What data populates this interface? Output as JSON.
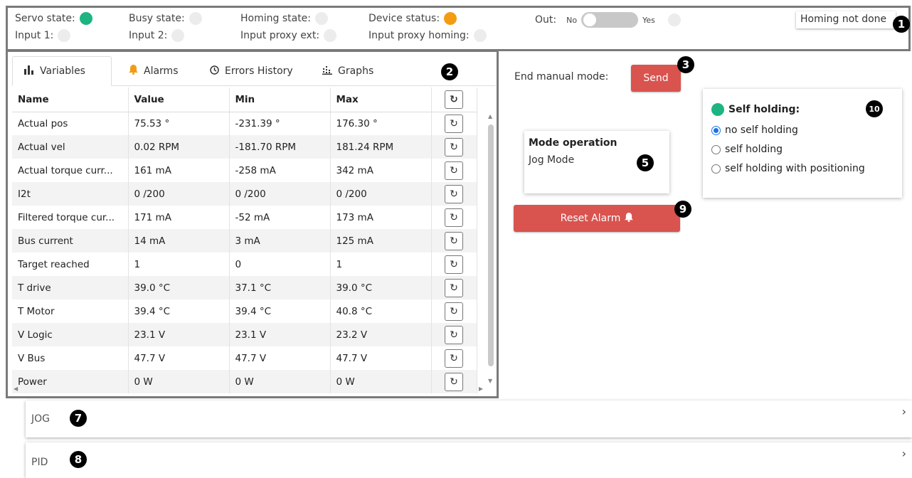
{
  "status": {
    "servo_state": "Servo state:",
    "busy_state": "Busy state:",
    "homing_state": "Homing state:",
    "device_status": "Device status:",
    "out_label": "Out:",
    "out_no": "No",
    "out_yes": "Yes",
    "input1": "Input 1:",
    "input2": "Input 2:",
    "input_proxy_ext": "Input proxy ext:",
    "input_proxy_homing": "Input proxy homing:",
    "homing_message": "Homing not done",
    "colors": {
      "green": "#1db481",
      "orange": "#f39c12",
      "off": "#ececec"
    }
  },
  "markers": {
    "m1": "1",
    "m2": "2",
    "m3": "3",
    "m5": "5",
    "m7": "7",
    "m8": "8",
    "m9": "9",
    "m10": "10"
  },
  "tabs": [
    {
      "label": "Variables",
      "icon": "bar-chart-icon"
    },
    {
      "label": "Alarms",
      "icon": "bell-icon"
    },
    {
      "label": "Errors History",
      "icon": "clock-icon"
    },
    {
      "label": "Graphs",
      "icon": "graph-icon"
    }
  ],
  "table": {
    "headers": [
      "Name",
      "Value",
      "Min",
      "Max"
    ],
    "rows": [
      [
        "Actual pos",
        "75.53 °",
        "-231.39 °",
        "176.30 °"
      ],
      [
        "Actual vel",
        "0.02 RPM",
        "-181.70 RPM",
        "181.24 RPM"
      ],
      [
        "Actual torque curr...",
        "161 mA",
        "-258 mA",
        "342 mA"
      ],
      [
        "I2t",
        "0 /200",
        "0 /200",
        "0 /200"
      ],
      [
        "Filtered torque cur...",
        "171 mA",
        "-52 mA",
        "173 mA"
      ],
      [
        "Bus current",
        "14 mA",
        "3 mA",
        "125 mA"
      ],
      [
        "Target reached",
        "1",
        "0",
        "1"
      ],
      [
        "T drive",
        "39.0 °C",
        "37.1 °C",
        "39.0 °C"
      ],
      [
        "T Motor",
        "39.4 °C",
        "39.4 °C",
        "40.8 °C"
      ],
      [
        "V Logic",
        "23.1 V",
        "23.1 V",
        "23.2 V"
      ],
      [
        "V Bus",
        "47.7 V",
        "47.7 V",
        "47.7 V"
      ],
      [
        "Power",
        "0 W",
        "0 W",
        "0 W"
      ]
    ]
  },
  "manual": {
    "label": "End manual mode:",
    "send": "Send"
  },
  "mode": {
    "title": "Mode operation",
    "value": "Jog Mode"
  },
  "reset_alarm": "Reset Alarm",
  "self_holding": {
    "title": "Self holding:",
    "options": [
      "no self holding",
      "self holding",
      "self holding with positioning"
    ],
    "selected": 0
  },
  "accordions": {
    "jog": "JOG",
    "pid": "PID"
  }
}
